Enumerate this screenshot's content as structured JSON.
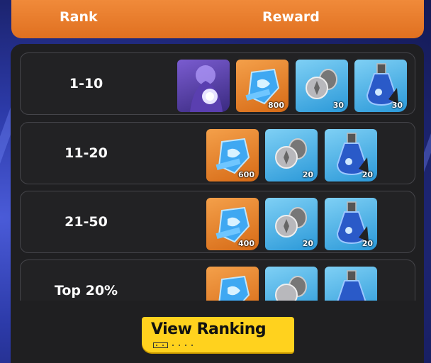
{
  "header": {
    "rank_label": "Rank",
    "reward_label": "Reward"
  },
  "rows": [
    {
      "rank": "1-10",
      "rewards": [
        {
          "icon": "hero-portrait-icon",
          "qty": ""
        },
        {
          "icon": "blue-gem-icon",
          "qty": "800"
        },
        {
          "icon": "silver-coin-icon",
          "qty": "30"
        },
        {
          "icon": "potion-flask-icon",
          "qty": "30"
        }
      ]
    },
    {
      "rank": "11-20",
      "rewards": [
        {
          "icon": "blue-gem-icon",
          "qty": "600"
        },
        {
          "icon": "silver-coin-icon",
          "qty": "20"
        },
        {
          "icon": "potion-flask-icon",
          "qty": "20"
        }
      ]
    },
    {
      "rank": "21-50",
      "rewards": [
        {
          "icon": "blue-gem-icon",
          "qty": "400"
        },
        {
          "icon": "silver-coin-icon",
          "qty": "20"
        },
        {
          "icon": "potion-flask-icon",
          "qty": "20"
        }
      ]
    },
    {
      "rank": "Top 20%",
      "rewards": [
        {
          "icon": "blue-gem-icon",
          "qty": ""
        },
        {
          "icon": "silver-coin-icon",
          "qty": ""
        },
        {
          "icon": "potion-flask-icon",
          "qty": ""
        }
      ]
    }
  ],
  "button": {
    "label": "View Ranking"
  },
  "colors": {
    "header": "#e8792a",
    "button": "#ffd21e",
    "panel": "#1f1f21"
  }
}
